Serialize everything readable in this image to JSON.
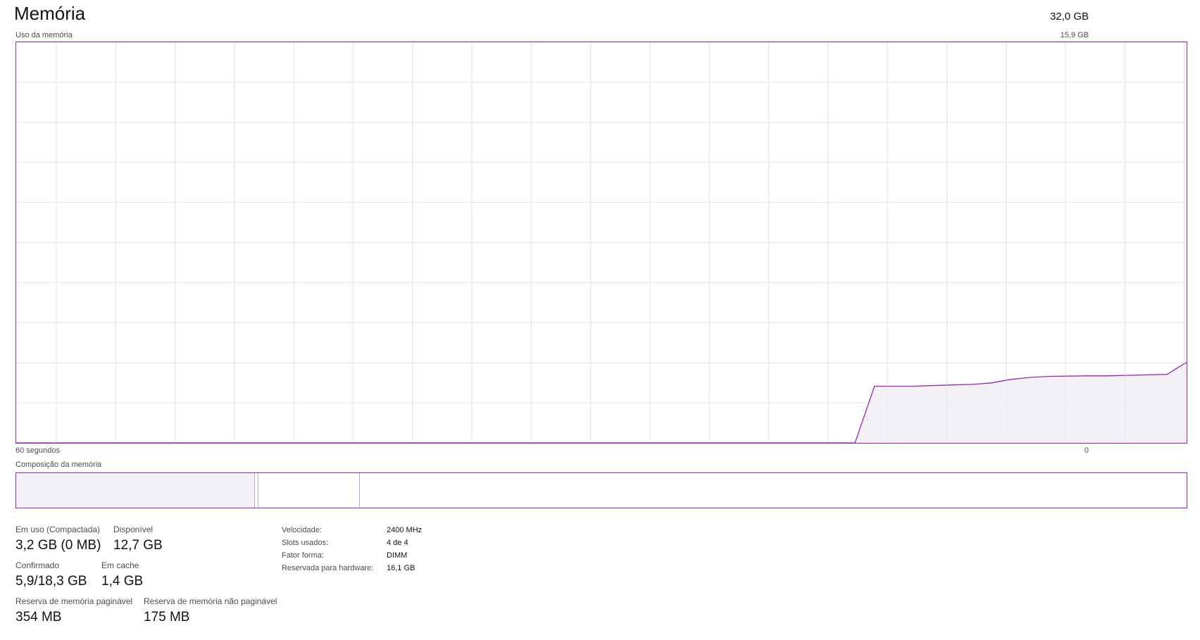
{
  "header": {
    "title": "Memória",
    "total": "32,0 GB"
  },
  "usage_chart": {
    "label": "Uso da memória",
    "max_label": "15,9 GB",
    "time_left": "60 segundos",
    "time_right": "0",
    "line_color": "#9528b4",
    "fill_color": "#f1eef4",
    "grid_color": "#e6dff0"
  },
  "chart_data": {
    "type": "area",
    "title": "Uso da memória",
    "xlabel": "",
    "ylabel": "",
    "x": [
      60,
      58,
      56,
      54,
      52,
      50,
      48,
      46,
      44,
      42,
      40,
      38,
      36,
      34,
      32,
      30,
      28,
      26,
      24,
      22,
      20,
      18,
      17,
      16,
      14,
      12,
      11,
      10,
      9,
      8,
      7,
      6,
      5,
      4,
      3,
      2,
      1,
      0
    ],
    "values": [
      0,
      0,
      0,
      0,
      0,
      0,
      0,
      0,
      0,
      0,
      0,
      0,
      0,
      0,
      0,
      0,
      0,
      0,
      0,
      0,
      0,
      0,
      0,
      2.25,
      2.25,
      2.3,
      2.32,
      2.38,
      2.52,
      2.6,
      2.64,
      2.65,
      2.66,
      2.66,
      2.68,
      2.7,
      2.72,
      3.2
    ],
    "ylim": [
      0,
      15.9
    ],
    "xlim": [
      60,
      0
    ],
    "grid": true
  },
  "composition": {
    "label": "Composição da memória"
  },
  "stats": {
    "in_use_label": "Em uso (Compactada)",
    "in_use_value": "3,2 GB (0 MB)",
    "available_label": "Disponível",
    "available_value": "12,7 GB",
    "committed_label": "Confirmado",
    "committed_value": "5,9/18,3 GB",
    "cached_label": "Em cache",
    "cached_value": "1,4 GB",
    "paged_label": "Reserva de memória paginável",
    "paged_value": "354 MB",
    "nonpaged_label": "Reserva de memória não paginável",
    "nonpaged_value": "175 MB"
  },
  "specs": {
    "speed_label": "Velocidade:",
    "speed_value": "2400 MHz",
    "slots_label": "Slots usados:",
    "slots_value": "4 de 4",
    "form_label": "Fator forma:",
    "form_value": "DIMM",
    "reserved_label": "Reservada para hardware:",
    "reserved_value": "16,1 GB"
  }
}
